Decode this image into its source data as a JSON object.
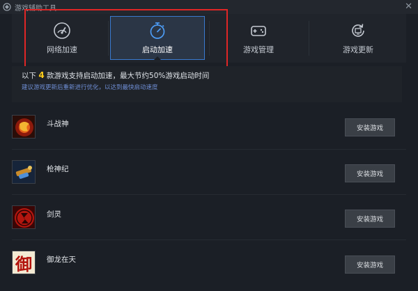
{
  "window": {
    "title": "游戏辅助工具",
    "close_label": "✕"
  },
  "tabs": [
    {
      "label": "网络加速",
      "icon": "speedometer-icon"
    },
    {
      "label": "启动加速",
      "icon": "stopwatch-icon",
      "active": true
    },
    {
      "label": "游戏管理",
      "icon": "gamepad-icon"
    },
    {
      "label": "游戏更新",
      "icon": "update-icon"
    }
  ],
  "info": {
    "prefix": "以下",
    "count": "4",
    "suffix": "款游戏支持启动加速，最大节约50%游戏启动时间",
    "tip": "建议游戏更新后重新进行优化，以达到最快启动速度"
  },
  "games": [
    {
      "name": "斗战神",
      "button": "安装游戏"
    },
    {
      "name": "枪神纪",
      "button": "安装游戏"
    },
    {
      "name": "剑灵",
      "button": "安装游戏"
    },
    {
      "name": "御龙在天",
      "button": "安装游戏",
      "icon_text": "御"
    }
  ],
  "colors": {
    "background": "#1b1f26",
    "active_tab_border": "#3a7ad0",
    "highlight_box": "#e02626",
    "count_highlight": "#ffcc1a",
    "tip_text": "#6f8fd6"
  }
}
